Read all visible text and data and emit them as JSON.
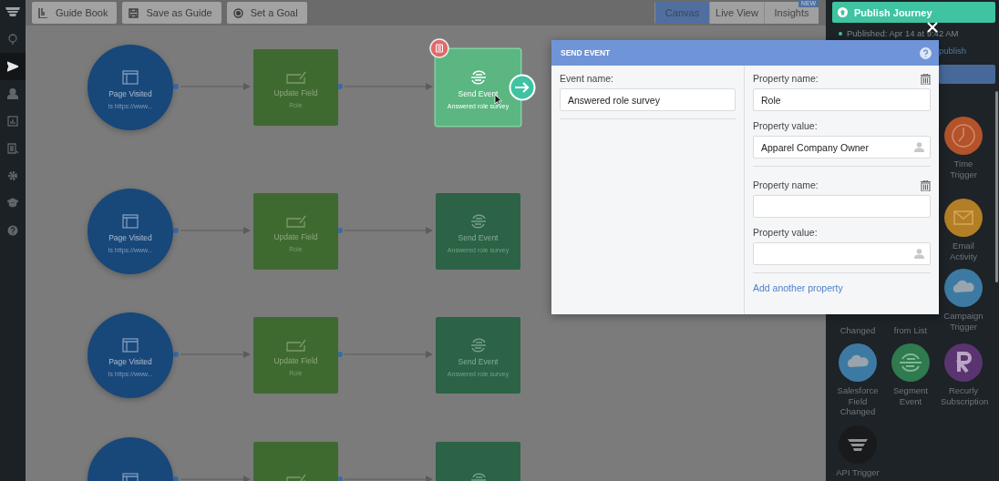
{
  "nav": {
    "items": [
      {
        "selected": false
      },
      {
        "selected": true
      },
      {
        "selected": false
      },
      {
        "selected": false
      },
      {
        "selected": false
      },
      {
        "selected": false
      },
      {
        "selected": false
      },
      {
        "selected": false
      }
    ]
  },
  "toolbar": {
    "buttons": [
      {
        "label": "Guide Book"
      },
      {
        "label": "Save as Guide"
      },
      {
        "label": "Set a Goal"
      }
    ],
    "tabs": [
      {
        "label": "Canvas",
        "selected": true
      },
      {
        "label": "Live View",
        "selected": false
      },
      {
        "label": "Insights",
        "selected": false,
        "badge": "NEW"
      }
    ]
  },
  "flows": [
    {
      "nodes": [
        {
          "kind": "page",
          "title": "Page Visited",
          "subtitle": "Is https://www..."
        },
        {
          "kind": "update",
          "title": "Update Field",
          "subtitle": "Role"
        },
        {
          "kind": "send",
          "title": "Send Event",
          "subtitle": "Answered role survey",
          "selected": true
        }
      ]
    },
    {
      "nodes": [
        {
          "kind": "page",
          "title": "Page Visited",
          "subtitle": "Is https://www..."
        },
        {
          "kind": "update",
          "title": "Update Field",
          "subtitle": "Role"
        },
        {
          "kind": "send",
          "title": "Send Event",
          "subtitle": "Answered role survey",
          "selected": false
        }
      ]
    },
    {
      "nodes": [
        {
          "kind": "page",
          "title": "Page Visited",
          "subtitle": "Is https://www..."
        },
        {
          "kind": "update",
          "title": "Update Field",
          "subtitle": "Role"
        },
        {
          "kind": "send",
          "title": "Send Event",
          "subtitle": "Answered role survey",
          "selected": false
        }
      ]
    },
    {
      "nodes": [
        {
          "kind": "page"
        },
        {
          "kind": "update"
        },
        {
          "kind": "send",
          "selected": false
        }
      ]
    }
  ],
  "panel": {
    "publish_button": "Publish Journey",
    "published": "Published: Apr 14 at 9:42 AM",
    "publish_link": "publish",
    "side_items": [
      {
        "kind": "clock",
        "label": "Time Trigger",
        "color": "#b3532b"
      },
      {
        "kind": "mail",
        "label": "Email Activity",
        "color": "#b27f26"
      }
    ],
    "grid_items": [
      {
        "kind": "partial",
        "label": "Changed"
      },
      {
        "kind": "partial",
        "label": "from List"
      },
      {
        "kind": "cloud",
        "label": "Campaign Trigger",
        "color": "#3d7aa3"
      },
      {
        "kind": "cloud",
        "label": "Salesforce Field Changed",
        "color": "#3d7aa3"
      },
      {
        "kind": "segment",
        "label": "Segment Event",
        "color": "#2f7a4e"
      },
      {
        "kind": "recurly",
        "label": "Recurly Subscription",
        "color": "#5a3470"
      },
      {
        "kind": "api",
        "label": "API Trigger",
        "color": "#181a1c"
      }
    ]
  },
  "dialog": {
    "title": "SEND EVENT",
    "event_label": "Event name:",
    "event_value": "Answered role survey",
    "properties": [
      {
        "name_label": "Property name:",
        "name_value": "Role",
        "value_label": "Property value:",
        "value_value": "Apparel Company Owner"
      },
      {
        "name_label": "Property name:",
        "value_label": "Property value:"
      }
    ],
    "add_link": "Add another property"
  }
}
